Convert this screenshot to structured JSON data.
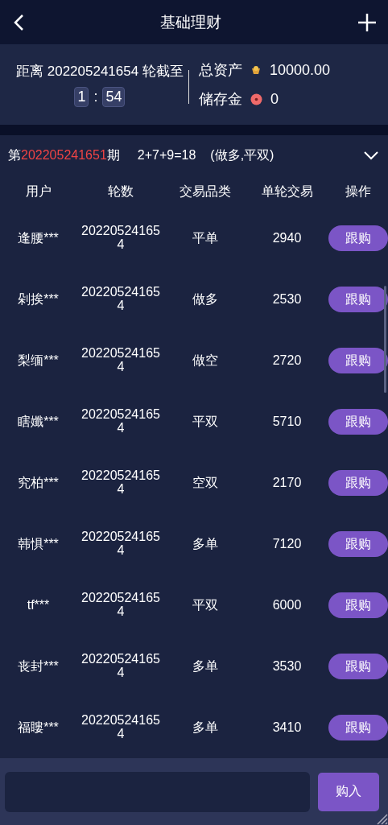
{
  "header": {
    "title": "基础理财"
  },
  "countdown": {
    "label": "距离 202205241654 轮截至",
    "minutes": "1",
    "separator": ":",
    "seconds": "54"
  },
  "assets": [
    {
      "label": "总资产",
      "kind": "gold",
      "value": "10000.00"
    },
    {
      "label": "储存金",
      "kind": "coin",
      "value": "0"
    }
  ],
  "period": {
    "prefix": "第",
    "number": "202205241651",
    "suffix": "期",
    "formula": "2+7+9=18",
    "result": "(做多,平双)"
  },
  "table": {
    "columns": [
      "用户",
      "轮数",
      "交易品类",
      "单轮交易",
      "操作"
    ],
    "rows": [
      {
        "user": "逢腰***",
        "round": "202205241654",
        "category": "平单",
        "amount": "2940",
        "action": "跟购"
      },
      {
        "user": "剁挨***",
        "round": "202205241654",
        "category": "做多",
        "amount": "2530",
        "action": "跟购"
      },
      {
        "user": "梨缅***",
        "round": "202205241654",
        "category": "做空",
        "amount": "2720",
        "action": "跟购"
      },
      {
        "user": "瞎孅***",
        "round": "202205241654",
        "category": "平双",
        "amount": "5710",
        "action": "跟购"
      },
      {
        "user": "究柏***",
        "round": "202205241654",
        "category": "空双",
        "amount": "2170",
        "action": "跟购"
      },
      {
        "user": "韩惧***",
        "round": "202205241654",
        "category": "多单",
        "amount": "7120",
        "action": "跟购"
      },
      {
        "user": "tf***",
        "round": "202205241654",
        "category": "平双",
        "amount": "6000",
        "action": "跟购"
      },
      {
        "user": "丧封***",
        "round": "202205241654",
        "category": "多单",
        "amount": "3530",
        "action": "跟购"
      },
      {
        "user": "福瞜***",
        "round": "202205241654",
        "category": "多单",
        "amount": "3410",
        "action": "跟购"
      }
    ]
  },
  "footer": {
    "button": "购入"
  }
}
